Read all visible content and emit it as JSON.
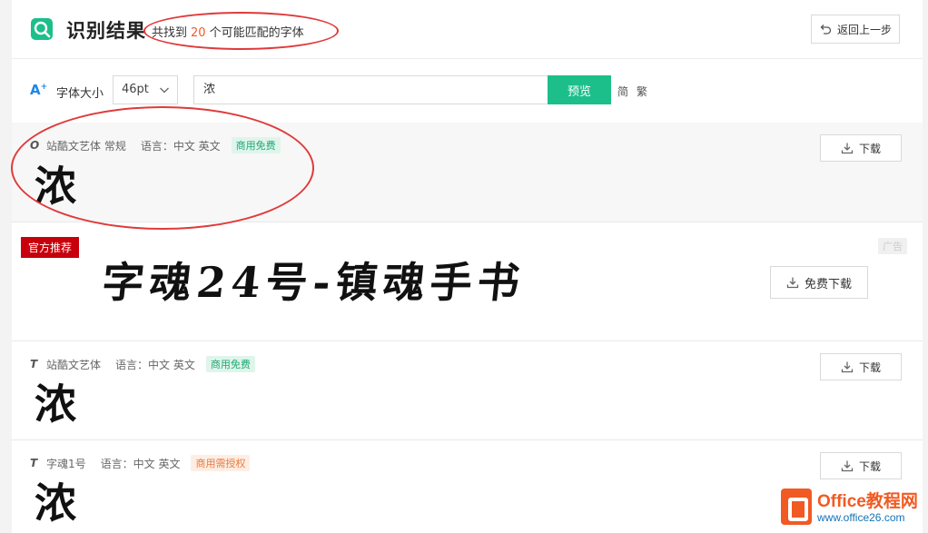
{
  "header": {
    "title": "识别结果",
    "summary_prefix": "共找到",
    "summary_count": "20",
    "summary_suffix": "个可能匹配的字体",
    "back_label": "返回上一步"
  },
  "toolbar": {
    "font_size_icon": "A",
    "font_size_label": "字体大小",
    "font_size_value": "46pt",
    "input_value": "浓",
    "preview_label": "预览",
    "simplified_label": "简",
    "traditional_label": "繁"
  },
  "results": [
    {
      "font_name": "站酷文艺体 常规",
      "language": "语言：中文 英文",
      "license": "商用免费",
      "glyph": "浓",
      "download_label": "下载"
    },
    {
      "font_name": "站酷文艺体",
      "language": "语言：中文 英文",
      "license": "商用免费",
      "glyph": "浓",
      "download_label": "下载"
    },
    {
      "font_name": "字魂1号",
      "language": "语言：中文 英文",
      "license": "商用需授权",
      "glyph": "浓",
      "download_label": "下载"
    }
  ],
  "ad": {
    "tag": "官方推荐",
    "label": "广告",
    "font_preview": "字魂24号-镇魂手书",
    "download_label": "免费下载"
  },
  "watermark": {
    "title": "Office教程网",
    "url": "www.office26.com"
  },
  "colors": {
    "accent": "#1cbf8a",
    "count": "#f05a28",
    "ad_tag": "#c7000b",
    "annotation": "#e03a3a"
  }
}
